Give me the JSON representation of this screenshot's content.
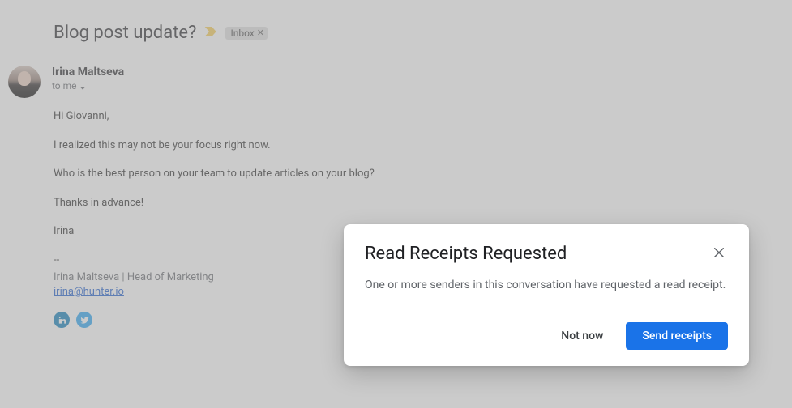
{
  "email": {
    "subject": "Blog post update?",
    "label": "Inbox",
    "sender": "Irina Maltseva",
    "to_line": "to me",
    "body": {
      "greeting": "Hi Giovanni,",
      "line1": "I realized this may not be your focus right now.",
      "line2": "Who is the best person on your team to update articles on your blog?",
      "thanks": "Thanks in advance!",
      "signoff": "Irina"
    },
    "signature": {
      "sep": "--",
      "role": "Irina Maltseva | Head of Marketing",
      "email": "irina@hunter.io"
    },
    "social": {
      "linkedin_icon": "linkedin",
      "twitter_icon": "twitter"
    }
  },
  "dialog": {
    "title": "Read Receipts Requested",
    "message": "One or more senders in this conversation have requested a read receipt.",
    "not_now": "Not now",
    "send": "Send receipts"
  }
}
